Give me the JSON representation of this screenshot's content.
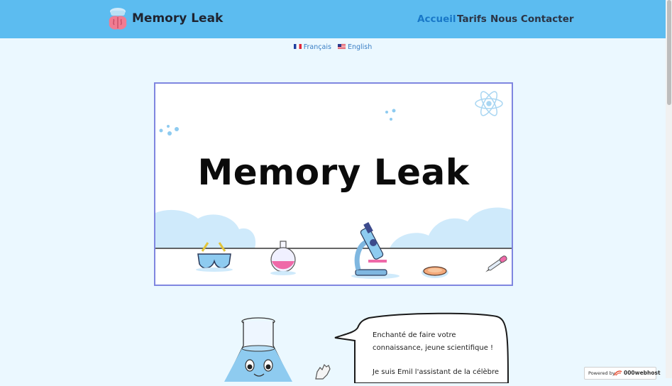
{
  "header": {
    "brand": "Memory Leak",
    "nav": [
      {
        "label": "Accueil",
        "active": true
      },
      {
        "label": "Tarifs",
        "active": false
      },
      {
        "label": "Nous Contacter",
        "active": false
      }
    ]
  },
  "languages": [
    {
      "label": "Français",
      "flag": "flag-fr-icon"
    },
    {
      "label": "English",
      "flag": "flag-us-icon"
    }
  ],
  "hero": {
    "title": "Memory Leak"
  },
  "speech": {
    "lines": [
      "Enchanté de faire votre connaissance, jeune scientifique !",
      "Je suis Emil l'assistant de la célèbre"
    ]
  },
  "footer_badge": {
    "prefix": "Powered by",
    "brand": "000webhost"
  },
  "colors": {
    "navbar": "#5cbcf0",
    "page_bg": "#ebf8ff",
    "active_link": "#1978c8",
    "banner_border": "#7f86e0"
  }
}
